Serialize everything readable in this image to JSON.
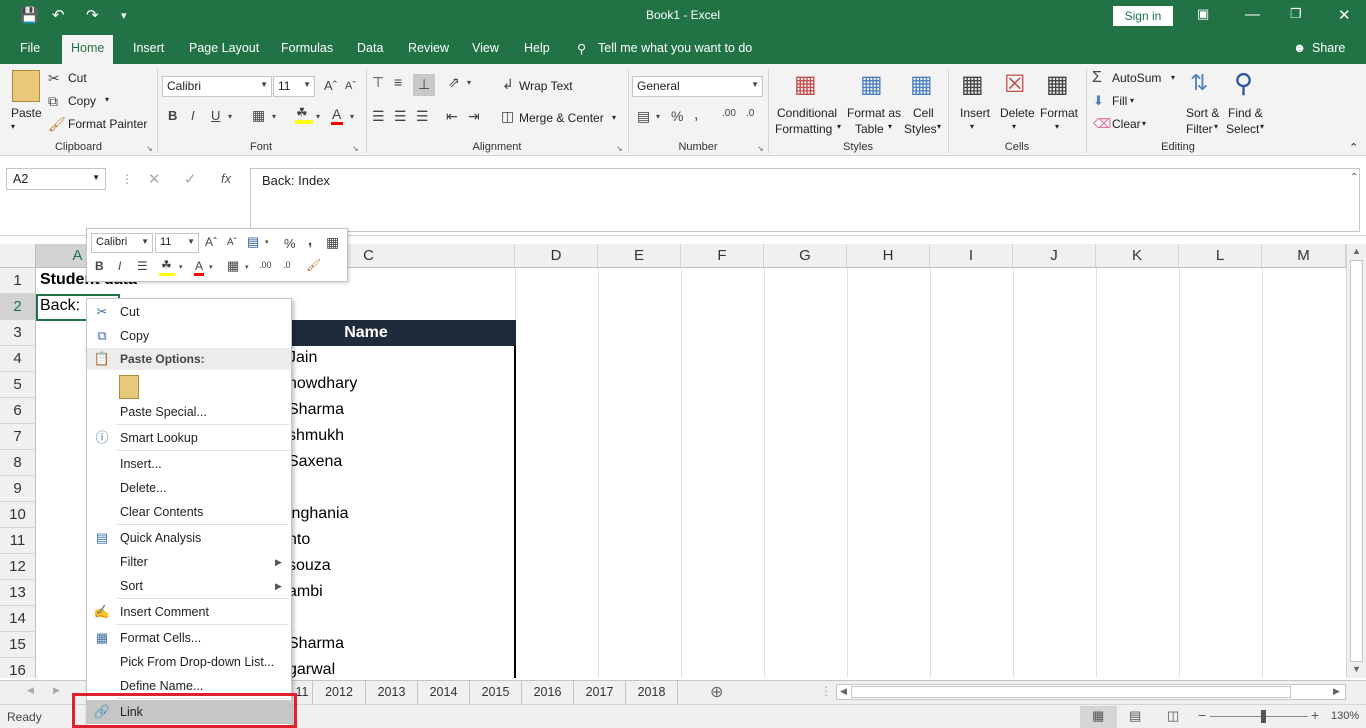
{
  "titlebar": {
    "title": "Book1  -  Excel",
    "signin": "Sign in"
  },
  "tabs": [
    "File",
    "Home",
    "Insert",
    "Page Layout",
    "Formulas",
    "Data",
    "Review",
    "View",
    "Help"
  ],
  "tell_me": "Tell me what you want to do",
  "share": "Share",
  "ribbon": {
    "clipboard": {
      "paste": "Paste",
      "cut": "Cut",
      "copy": "Copy",
      "format_painter": "Format Painter",
      "label": "Clipboard"
    },
    "font": {
      "name": "Calibri",
      "size": "11",
      "label": "Font"
    },
    "alignment": {
      "wrap": "Wrap Text",
      "merge": "Merge & Center",
      "label": "Alignment"
    },
    "number": {
      "format": "General",
      "label": "Number"
    },
    "styles": {
      "conditional": [
        "Conditional",
        "Formatting"
      ],
      "format_table": [
        "Format as",
        "Table"
      ],
      "cell_styles": [
        "Cell",
        "Styles"
      ],
      "label": "Styles"
    },
    "cells": {
      "insert": "Insert",
      "delete": "Delete",
      "format": "Format",
      "label": "Cells"
    },
    "editing": {
      "autosum": "AutoSum",
      "fill": "Fill",
      "clear": "Clear",
      "sort": [
        "Sort &",
        "Filter"
      ],
      "find": [
        "Find &",
        "Select"
      ],
      "label": "Editing"
    }
  },
  "formula": {
    "namebox": "A2",
    "value": "Back: Index"
  },
  "columns": [
    "A",
    "B",
    "C",
    "D",
    "E",
    "F",
    "G",
    "H",
    "I",
    "J",
    "K",
    "L",
    "M"
  ],
  "rows": [
    "1",
    "2",
    "3",
    "4",
    "5",
    "6",
    "7",
    "8",
    "9",
    "10",
    "11",
    "12",
    "13",
    "14",
    "15",
    "16"
  ],
  "cells": {
    "a1": "Student data",
    "a2": "Back:",
    "name_header": "Name",
    "names": [
      "Jain",
      "howdhary",
      "Sharma",
      "shmukh",
      "Saxena",
      "",
      "inghania",
      "nto",
      "souza",
      "ambi",
      "",
      "Sharma",
      "garwal"
    ]
  },
  "mini_toolbar": {
    "font": "Calibri",
    "size": "11"
  },
  "context_menu": [
    {
      "label": "Cut",
      "icon": "scissors-icon"
    },
    {
      "label": "Copy",
      "icon": "copy-icon"
    },
    {
      "label": "Paste Options:",
      "icon": "clipboard-icon"
    },
    {
      "label": "Paste Special...",
      "icon": ""
    },
    {
      "label": "Smart Lookup",
      "icon": "info-icon"
    },
    {
      "label": "Insert...",
      "icon": ""
    },
    {
      "label": "Delete...",
      "icon": ""
    },
    {
      "label": "Clear Contents",
      "icon": ""
    },
    {
      "label": "Quick Analysis",
      "icon": "quick-analysis-icon"
    },
    {
      "label": "Filter",
      "icon": ""
    },
    {
      "label": "Sort",
      "icon": ""
    },
    {
      "label": "Insert Comment",
      "icon": "comment-icon"
    },
    {
      "label": "Format Cells...",
      "icon": "format-cells-icon"
    },
    {
      "label": "Pick From Drop-down List...",
      "icon": ""
    },
    {
      "label": "Define Name...",
      "icon": ""
    },
    {
      "label": "Link",
      "icon": "link-icon"
    }
  ],
  "sheet_tabs": [
    "11",
    "2012",
    "2013",
    "2014",
    "2015",
    "2016",
    "2017",
    "2018"
  ],
  "status": {
    "ready": "Ready",
    "zoom": "130%"
  },
  "colors": {
    "excel_green": "#217346",
    "highlight": "#e0202a"
  }
}
